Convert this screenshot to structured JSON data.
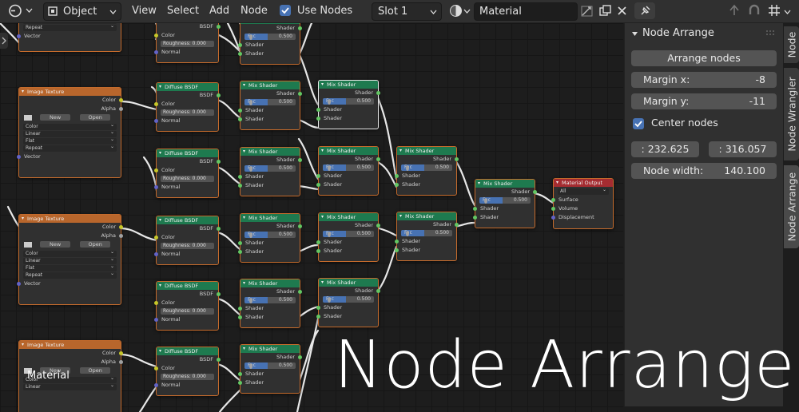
{
  "header": {
    "mode": "Object",
    "menus": [
      "View",
      "Select",
      "Add",
      "Node"
    ],
    "use_nodes_label": "Use Nodes",
    "slot": "Slot 1",
    "material_name": "Material"
  },
  "panel": {
    "title": "Node Arrange",
    "arrange_button": "Arrange nodes",
    "margin_x_label": "Margin x:",
    "margin_x_value": "-8",
    "margin_y_label": "Margin y:",
    "margin_y_value": "-11",
    "center_nodes_label": "Center nodes",
    "coord_x": ": 232.625",
    "coord_y": ": 316.057",
    "node_width_label": "Node width:",
    "node_width_value": "140.100"
  },
  "tabs": [
    "Node",
    "Node Wrangler",
    "Node Arrange"
  ],
  "nodes": {
    "image_texture_title": "Image Texture",
    "diffuse_title": "Diffuse BSDF",
    "mix_title": "Mix Shader",
    "output_title": "Material Output",
    "color": "Color",
    "alpha": "Alpha",
    "new": "New",
    "open": "Open",
    "color_mode": "Color",
    "interp": "Linear",
    "proj": "Flat",
    "ext": "Repeat",
    "vector": "Vector",
    "bsdf": "BSDF",
    "roughness": "Roughness",
    "roughness_value": "0.000",
    "normal": "Normal",
    "shader": "Shader",
    "fac": "Fac",
    "fac_value": "0.500",
    "output_target": "All",
    "surface": "Surface",
    "volume": "Volume",
    "displacement": "Displacement"
  },
  "overlay_title": "Node Arrange",
  "overlay_small": "Material"
}
